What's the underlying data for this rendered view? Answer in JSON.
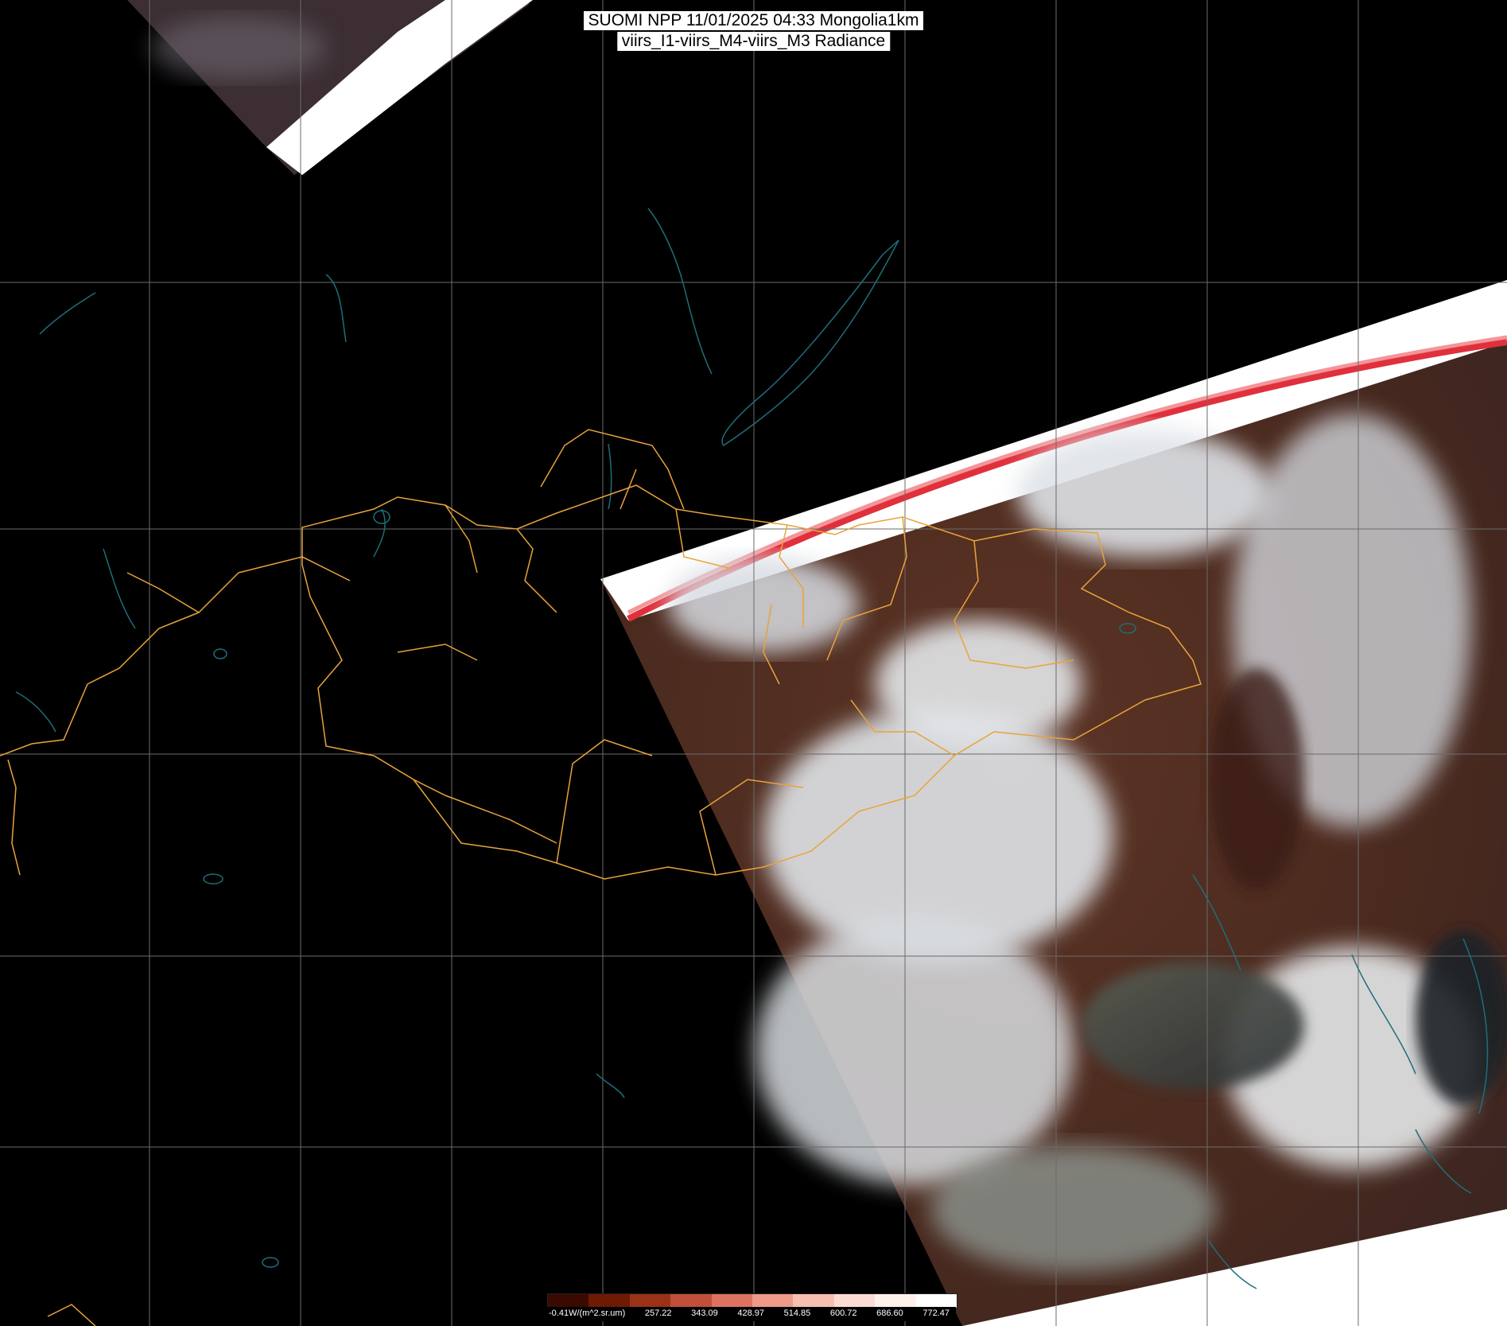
{
  "title": {
    "line1": "SUOMI NPP 11/01/2025 04:33 Mongolia1km",
    "line2": "viirs_I1-viirs_M4-viirs_M3 Radiance"
  },
  "colorbar": {
    "min_label": "-0.41W/(m^2.sr.um)",
    "tick_labels": [
      "257.22",
      "343.09",
      "428.97",
      "514.85",
      "600.72",
      "686.60",
      "772.47"
    ],
    "colors": [
      "#3a0a00",
      "#6e1a05",
      "#9a3218",
      "#c0503a",
      "#dc7360",
      "#ee9a8a",
      "#f6bfb2",
      "#fbdcd3",
      "#fff0ec",
      "#ffffff"
    ]
  },
  "colors": {
    "border": "#e8a33a",
    "coast": "#1e6e7a",
    "grid": "#7a7a7a",
    "land": "#4a2a1f",
    "cloud": "#dfe3e8"
  }
}
